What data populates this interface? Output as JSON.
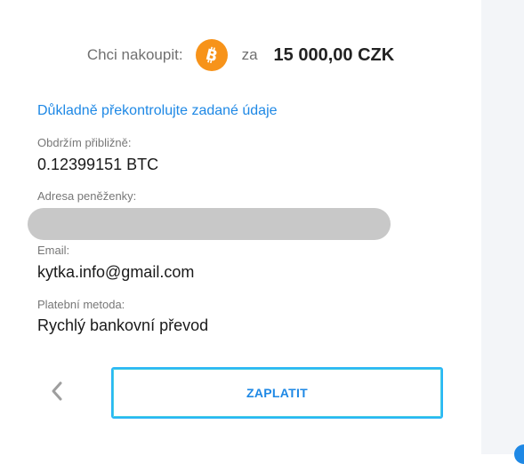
{
  "purchase": {
    "label": "Chci nakoupit:",
    "coin_icon": "bitcoin-icon",
    "coin_color": "#f7931a",
    "connector": "za",
    "amount": "15 000,00 CZK"
  },
  "review_note": "Důkladně překontrolujte zadané údaje",
  "fields": {
    "receive": {
      "label": "Obdržím přibližně:",
      "value": "0.12399151 BTC"
    },
    "wallet": {
      "label": "Adresa peněženky:",
      "value": ""
    },
    "email": {
      "label": "Email:",
      "value": "kytka.info@gmail.com"
    },
    "payment": {
      "label": "Platební metoda:",
      "value": "Rychlý bankovní převod"
    }
  },
  "actions": {
    "back_icon": "chevron-left-icon",
    "pay_label": "ZAPLATIT"
  },
  "colors": {
    "accent": "#1e88e5",
    "button_border": "#29b6f6",
    "redaction": "#c8c8c8"
  }
}
